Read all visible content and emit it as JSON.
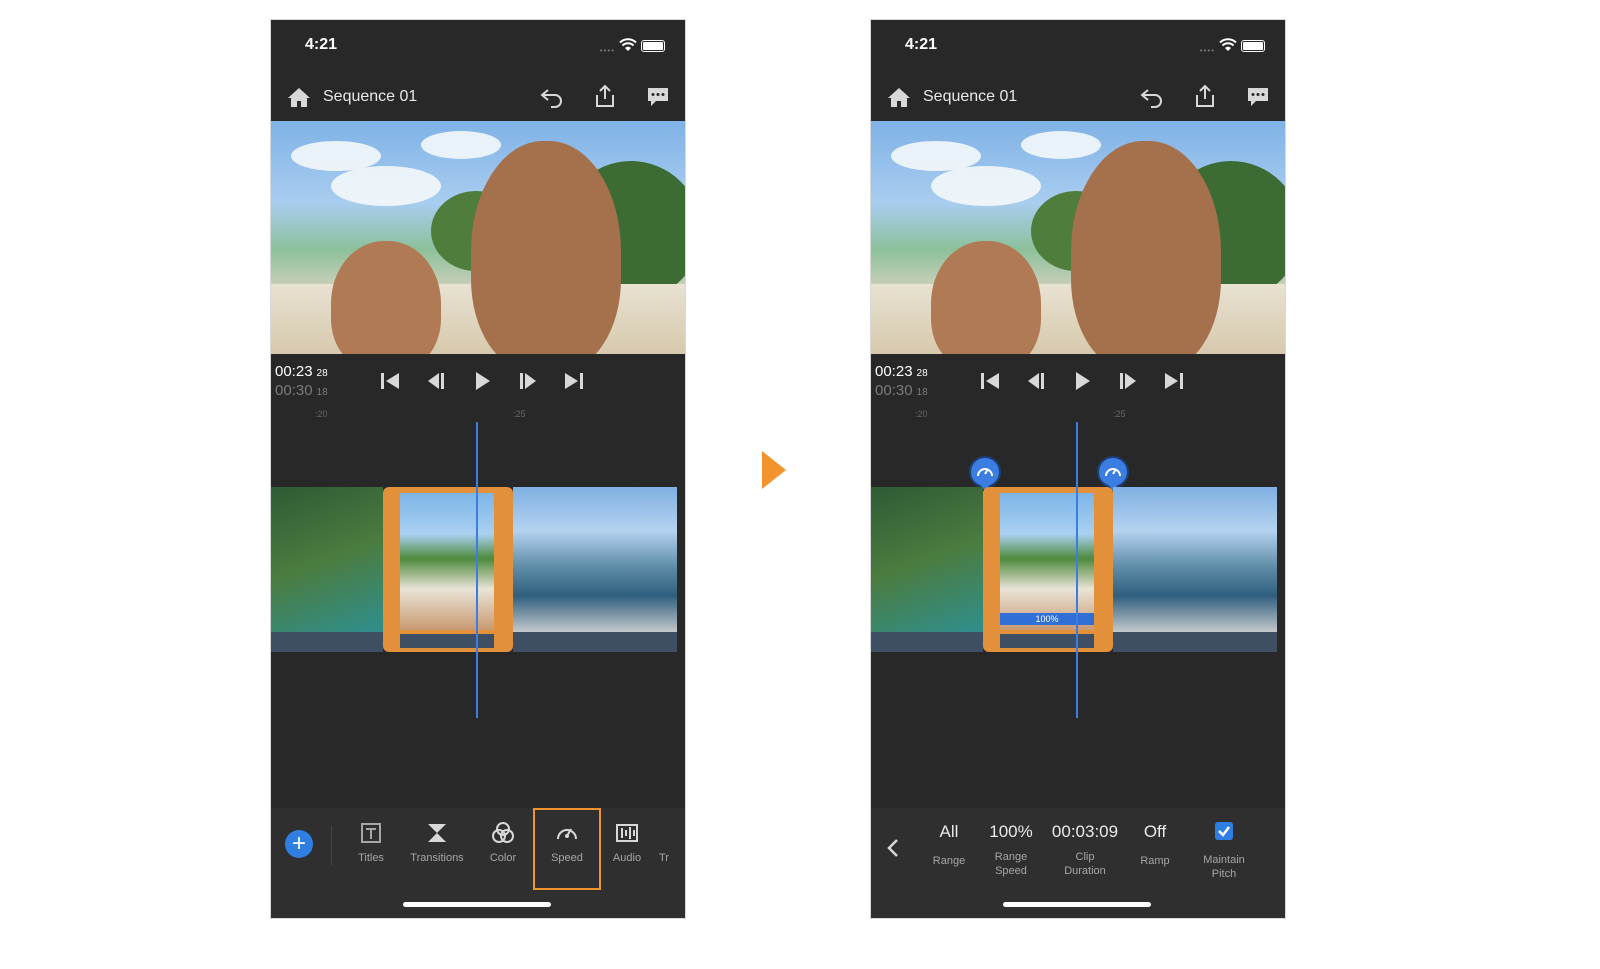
{
  "status": {
    "time": "4:21"
  },
  "nav": {
    "title": "Sequence 01"
  },
  "timecode": {
    "current_main": "00:23",
    "current_frames": "28",
    "total_main": "00:30",
    "total_frames": "18"
  },
  "ruler": {
    "tick_a": ":20",
    "tick_b": ":25"
  },
  "left_toolbar": {
    "tools": [
      {
        "label": "Titles",
        "icon": "titles-icon"
      },
      {
        "label": "Transitions",
        "icon": "transitions-icon"
      },
      {
        "label": "Color",
        "icon": "color-icon"
      },
      {
        "label": "Speed",
        "icon": "speed-icon"
      },
      {
        "label": "Audio",
        "icon": "audio-icon"
      },
      {
        "label": "Tr",
        "icon": ""
      }
    ]
  },
  "speed_bar": {
    "value": "100%"
  },
  "right_options": {
    "range": {
      "value": "All",
      "label": "Range"
    },
    "range_speed": {
      "value": "100%",
      "label_1": "Range",
      "label_2": "Speed"
    },
    "clip_duration": {
      "value": "00:03:09",
      "label_1": "Clip",
      "label_2": "Duration"
    },
    "ramp": {
      "value": "Off",
      "label": "Ramp"
    },
    "maintain_pitch": {
      "checked": true,
      "label_1": "Maintain",
      "label_2": "Pitch"
    }
  },
  "colors": {
    "accent": "#f2932e",
    "blue": "#2f7fe3",
    "background": "#282828"
  }
}
